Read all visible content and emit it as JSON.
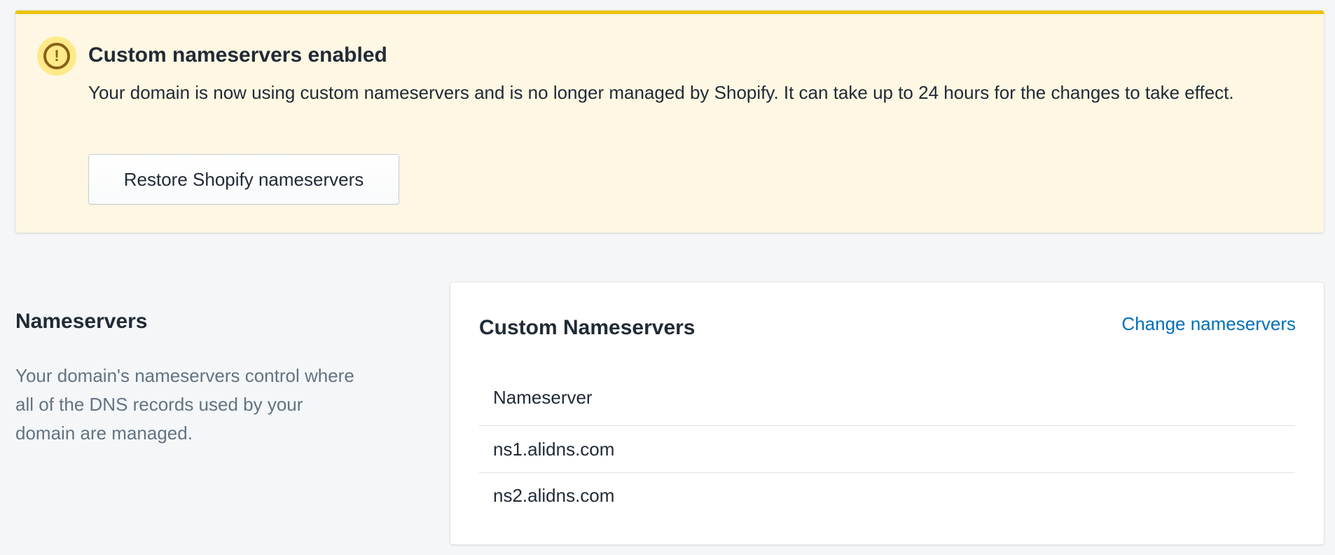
{
  "banner": {
    "title": "Custom nameservers enabled",
    "body": "Your domain is now using custom nameservers and is no longer managed by Shopify. It can take up to 24 hours for the changes to take effect.",
    "icon": "alert-circle-icon",
    "icon_glyph": "!",
    "button_label": "Restore Shopify nameservers",
    "accent_color": "#eec200",
    "background_color": "#fdf7e3"
  },
  "section": {
    "title": "Nameservers",
    "description": "Your domain's nameservers control where all of the DNS records used by your domain are managed."
  },
  "card": {
    "title": "Custom Nameservers",
    "action_label": "Change nameservers",
    "link_color": "#006fbb",
    "table": {
      "header": "Nameserver",
      "rows": [
        "ns1.alidns.com",
        "ns2.alidns.com"
      ]
    }
  }
}
